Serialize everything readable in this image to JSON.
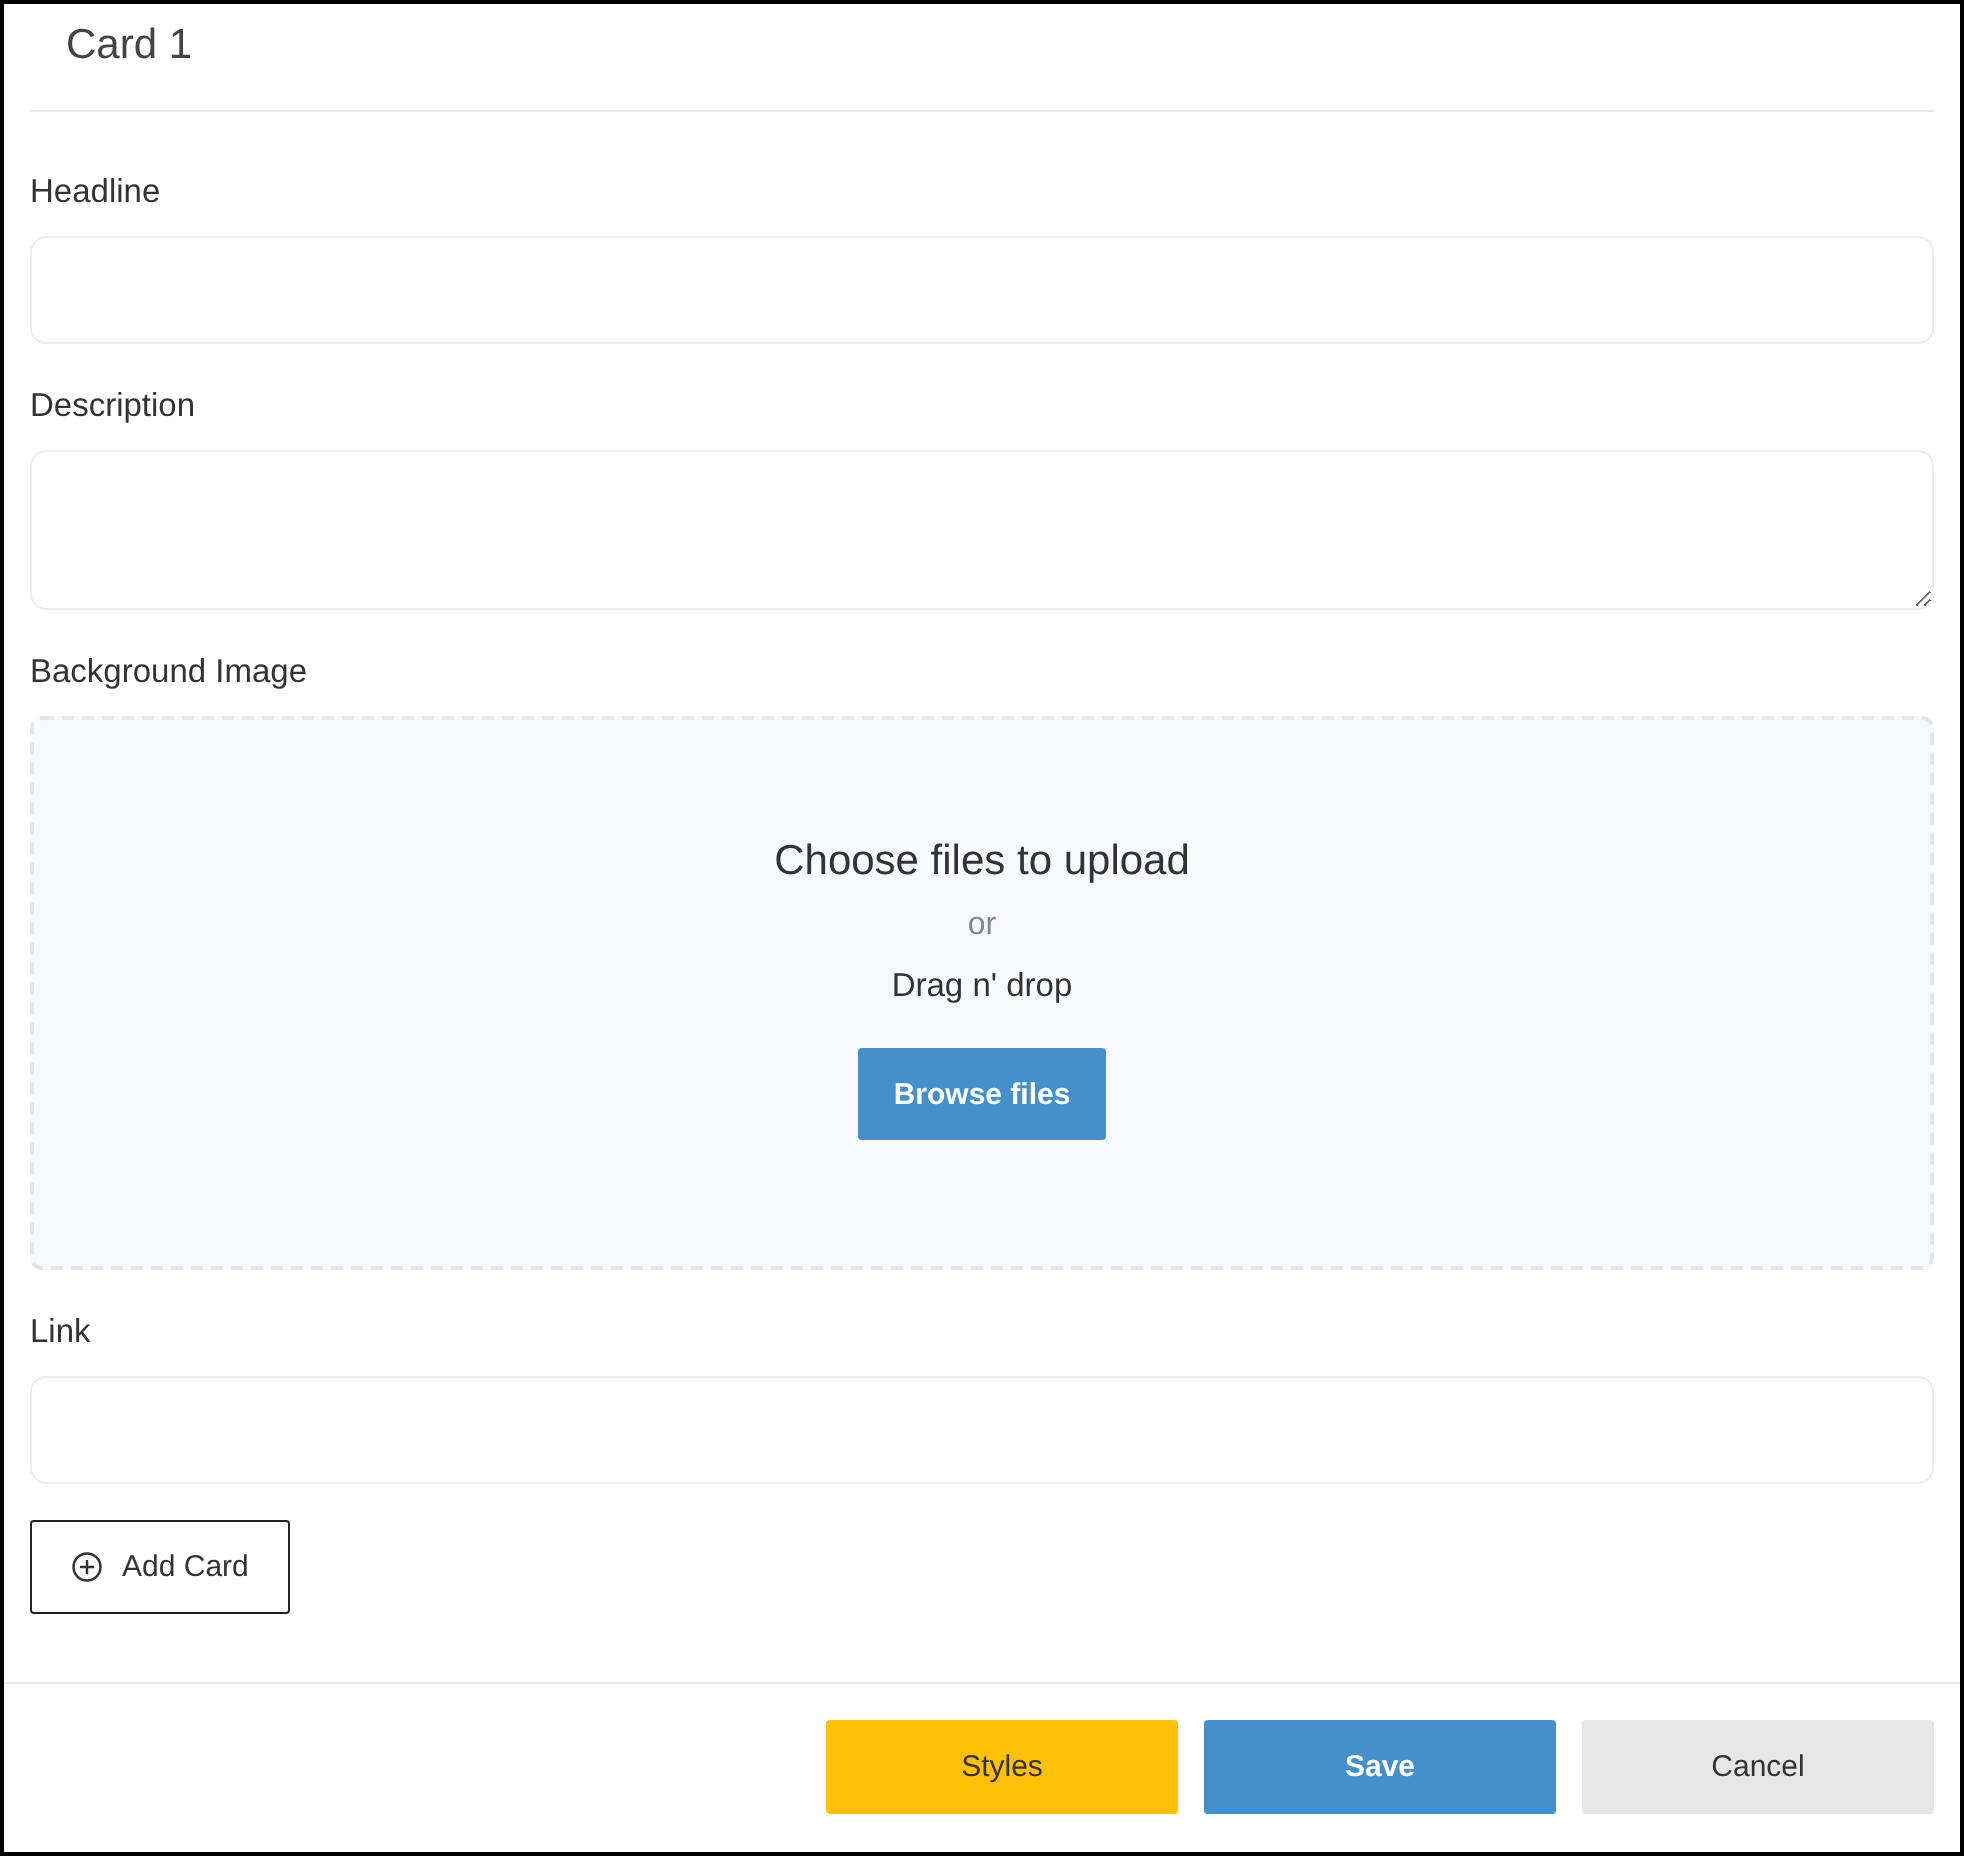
{
  "card": {
    "title": "Card 1"
  },
  "fields": [
    {
      "kind": "input",
      "label": "Headline"
    },
    {
      "kind": "textarea",
      "label": "Description"
    },
    {
      "kind": "upload",
      "label": "Background Image",
      "prompt": "Choose files to upload",
      "separator": "or",
      "hint": "Drag n' drop",
      "button": "Browse files"
    },
    {
      "kind": "input",
      "label": "Link"
    }
  ],
  "add_button": {
    "label": "Add Card"
  },
  "footer_buttons": [
    {
      "label": "Styles",
      "kind": "warning"
    },
    {
      "label": "Save",
      "kind": "primary"
    },
    {
      "label": "Cancel",
      "kind": "default"
    }
  ]
}
